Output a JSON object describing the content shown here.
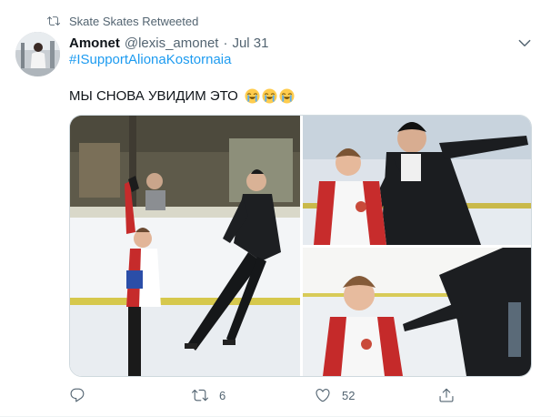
{
  "retweet_banner": {
    "text": "Skate Skates Retweeted",
    "icon": "retweet-icon"
  },
  "author": {
    "name": "Amonet",
    "handle": "@lexis_amonet",
    "separator": "·",
    "date": "Jul 31"
  },
  "tweet": {
    "hashtag": "#ISupportAlionaKostornaia",
    "text": "МЫ СНОВА УВИДИМ ЭТО",
    "emoji": [
      "crying-face",
      "crying-face",
      "crying-face"
    ]
  },
  "media": {
    "photos": [
      {
        "name": "skater-spiral-with-coach"
      },
      {
        "name": "skater-and-coach-closeup"
      },
      {
        "name": "skater-rink-closeup"
      }
    ]
  },
  "actions": {
    "reply_count": "",
    "retweet_count": "6",
    "like_count": "52"
  },
  "colors": {
    "link": "#1d9bf0",
    "secondary_text": "#536471",
    "primary_text": "#0f1419"
  }
}
